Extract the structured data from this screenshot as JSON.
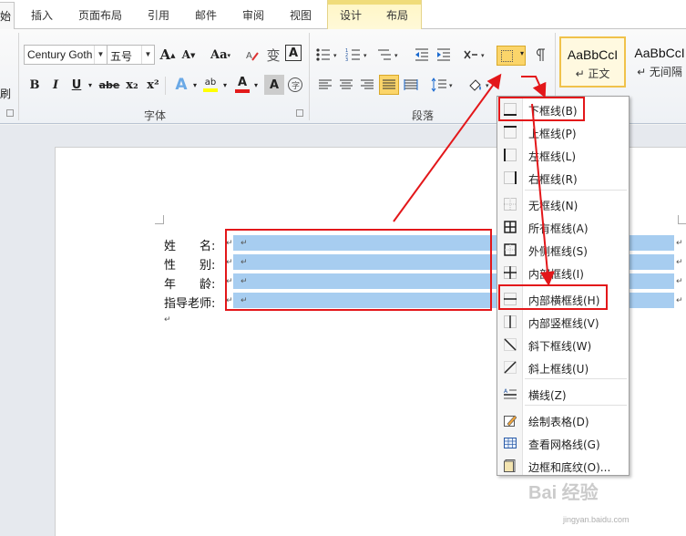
{
  "tabs": {
    "active_partial": "始",
    "items": [
      "插入",
      "页面布局",
      "引用",
      "邮件",
      "审阅",
      "视图",
      "设计",
      "布局"
    ]
  },
  "ribbon": {
    "left_partial_label": "刷",
    "font": {
      "name_value": "Century Goth",
      "size_value": "五号",
      "grow_label": "A",
      "shrink_label": "A",
      "case_label": "Aa",
      "bold_label": "B",
      "italic_label": "I",
      "underline_label": "U",
      "strike_label": "abe",
      "sub_label": "x₂",
      "sup_label": "x²",
      "text_effect_label": "A",
      "highlight_label": "ab",
      "color_label": "A",
      "char_border_label": "A",
      "phonetic_label": "变",
      "group_label": "字体"
    },
    "paragraph": {
      "group_label": "段落"
    },
    "styles": {
      "cards": [
        {
          "sample": "AaBbCcI",
          "name": "↵ 正文"
        },
        {
          "sample": "AaBbCcI",
          "name": "↵ 无间隔"
        }
      ]
    }
  },
  "document": {
    "rows": [
      {
        "label": "姓　　名:"
      },
      {
        "label": "性　　别:"
      },
      {
        "label": "年　　龄:"
      },
      {
        "label": "指导老师:"
      }
    ],
    "para_mark": "↵"
  },
  "border_menu": {
    "items": [
      {
        "label": "下框线(B)",
        "icon": "bottom-border-icon"
      },
      {
        "label": "上框线(P)",
        "icon": "top-border-icon"
      },
      {
        "label": "左框线(L)",
        "icon": "left-border-icon"
      },
      {
        "label": "右框线(R)",
        "icon": "right-border-icon"
      },
      {
        "label": "无框线(N)",
        "icon": "no-border-icon"
      },
      {
        "label": "所有框线(A)",
        "icon": "all-borders-icon"
      },
      {
        "label": "外侧框线(S)",
        "icon": "outside-borders-icon"
      },
      {
        "label": "内部框线(I)",
        "icon": "inside-borders-icon"
      },
      {
        "label": "内部横框线(H)",
        "icon": "inside-horizontal-border-icon"
      },
      {
        "label": "内部竖框线(V)",
        "icon": "inside-vertical-border-icon"
      },
      {
        "label": "斜下框线(W)",
        "icon": "diagonal-down-border-icon"
      },
      {
        "label": "斜上框线(U)",
        "icon": "diagonal-up-border-icon"
      },
      {
        "label": "横线(Z)",
        "icon": "horizontal-line-icon"
      },
      {
        "label": "绘制表格(D)",
        "icon": "draw-table-icon"
      },
      {
        "label": "查看网格线(G)",
        "icon": "view-gridlines-icon"
      },
      {
        "label": "边框和底纹(O)...",
        "icon": "borders-shading-icon"
      }
    ]
  },
  "watermark": {
    "text": "Bai 经验",
    "url": "jingyan.baidu.com"
  },
  "colors": {
    "highlight": "#e3171a",
    "selection": "#a7cdf0",
    "accent": "#fbd56a"
  }
}
